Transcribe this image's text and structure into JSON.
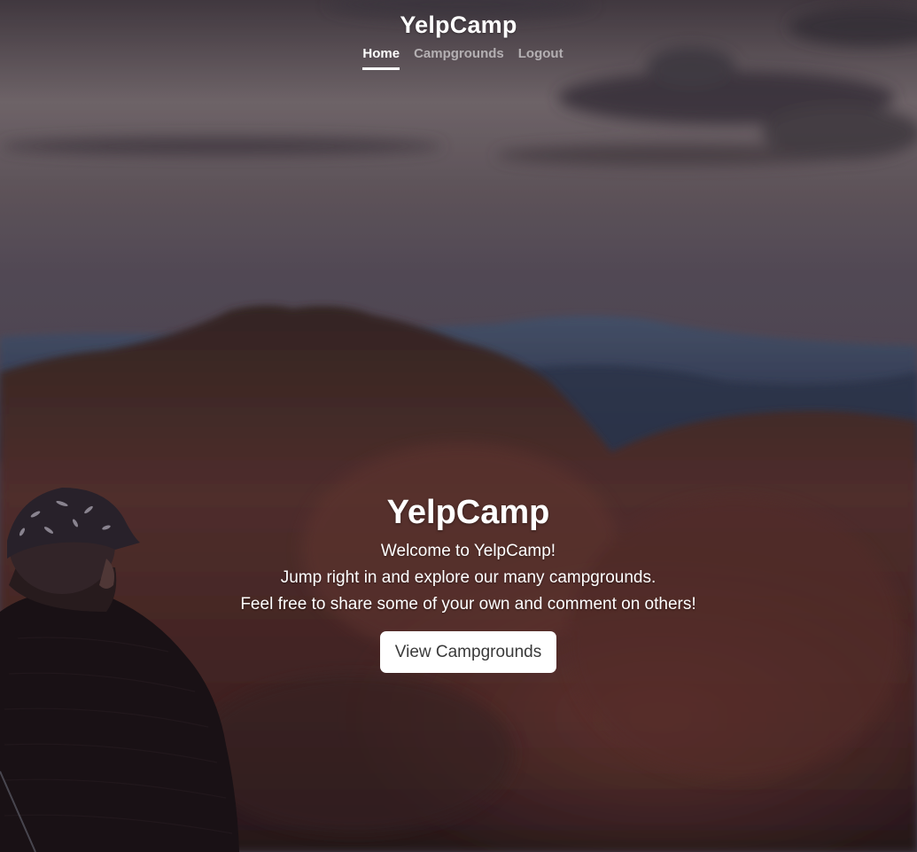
{
  "header": {
    "brand": "YelpCamp",
    "nav": [
      {
        "label": "Home",
        "active": true
      },
      {
        "label": "Campgrounds",
        "active": false
      },
      {
        "label": "Logout",
        "active": false
      }
    ]
  },
  "hero": {
    "title": "YelpCamp",
    "lines": [
      "Welcome to YelpCamp!",
      "Jump right in and explore our many campgrounds.",
      "Feel free to share some of your own and comment on others!"
    ],
    "button_label": "View Campgrounds"
  },
  "colors": {
    "accent": "#ffffff",
    "button_text": "#3a3a3a",
    "inactive_nav": "#a9a3a6",
    "sky_top": "#5a5058",
    "sky_mid": "#8a7d83",
    "rock": "#5a2f2c"
  }
}
